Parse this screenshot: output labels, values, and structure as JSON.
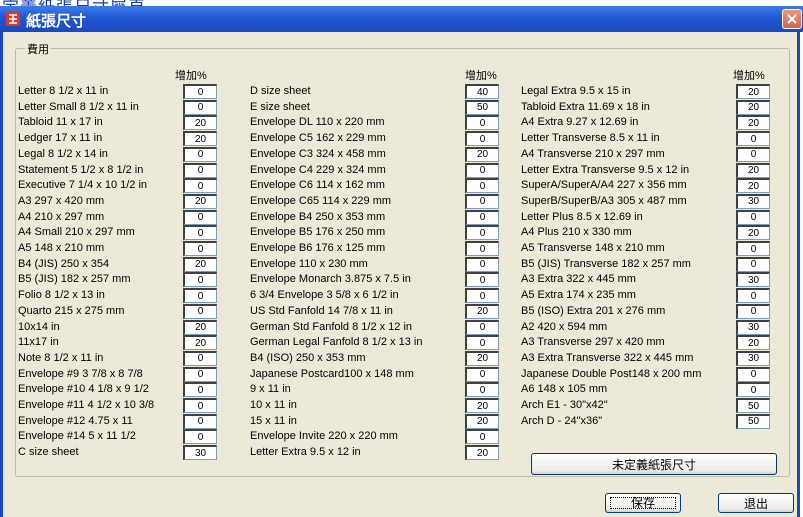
{
  "top_note": "定義紙張尺寸屬頁",
  "window": {
    "title": "紙張尺寸",
    "close_glyph": "✕"
  },
  "group": {
    "label": "費用"
  },
  "columns": [
    {
      "header": "增加%",
      "rows": [
        {
          "label": "Letter 8 1/2 x 11 in",
          "value": "0"
        },
        {
          "label": "Letter Small 8 1/2 x 11 in",
          "value": "0"
        },
        {
          "label": "Tabloid 11 x 17 in",
          "value": "20"
        },
        {
          "label": "Ledger 17 x 11 in",
          "value": "20"
        },
        {
          "label": "Legal 8 1/2 x 14 in",
          "value": "0"
        },
        {
          "label": "Statement 5 1/2 x 8 1/2 in",
          "value": "0"
        },
        {
          "label": "Executive 7 1/4 x 10 1/2 in",
          "value": "0"
        },
        {
          "label": "A3 297 x 420 mm",
          "value": "20"
        },
        {
          "label": "A4 210 x 297 mm",
          "value": "0"
        },
        {
          "label": "A4 Small 210 x 297 mm",
          "value": "0"
        },
        {
          "label": "A5 148 x 210 mm",
          "value": "0"
        },
        {
          "label": "B4 (JIS) 250 x 354",
          "value": "20"
        },
        {
          "label": "B5 (JIS) 182 x 257 mm",
          "value": "0"
        },
        {
          "label": "Folio 8 1/2 x 13 in",
          "value": "0"
        },
        {
          "label": "Quarto 215 x 275 mm",
          "value": "0"
        },
        {
          "label": "10x14 in",
          "value": "20"
        },
        {
          "label": "11x17 in",
          "value": "20"
        },
        {
          "label": "Note 8 1/2 x 11 in",
          "value": "0"
        },
        {
          "label": "Envelope #9 3 7/8 x 8 7/8",
          "value": "0"
        },
        {
          "label": "Envelope #10 4 1/8 x 9 1/2",
          "value": "0"
        },
        {
          "label": "Envelope #11 4 1/2 x 10 3/8",
          "value": "0"
        },
        {
          "label": "Envelope #12 4.75 x 11",
          "value": "0"
        },
        {
          "label": "Envelope #14 5 x 11 1/2",
          "value": "0"
        },
        {
          "label": "C size sheet",
          "value": "30"
        }
      ]
    },
    {
      "header": "增加%",
      "rows": [
        {
          "label": "D size sheet",
          "value": "40"
        },
        {
          "label": "E size sheet",
          "value": "50"
        },
        {
          "label": "Envelope DL 110 x 220 mm",
          "value": "0"
        },
        {
          "label": "Envelope C5 162 x 229 mm",
          "value": "0"
        },
        {
          "label": "Envelope C3  324 x 458 mm",
          "value": "20"
        },
        {
          "label": "Envelope C4  229 x 324 mm",
          "value": "0"
        },
        {
          "label": "Envelope C6  114 x 162 mm",
          "value": "0"
        },
        {
          "label": "Envelope C65 114 x 229 mm",
          "value": "0"
        },
        {
          "label": "Envelope B4  250 x 353 mm",
          "value": "0"
        },
        {
          "label": "Envelope B5  176 x 250 mm",
          "value": "0"
        },
        {
          "label": "Envelope B6  176 x 125 mm",
          "value": "0"
        },
        {
          "label": "Envelope 110 x 230 mm",
          "value": "0"
        },
        {
          "label": "Envelope Monarch 3.875 x 7.5 in",
          "value": "0"
        },
        {
          "label": "6 3/4 Envelope 3 5/8 x 6 1/2 in",
          "value": "0"
        },
        {
          "label": "US Std Fanfold 14 7/8 x 11 in",
          "value": "20"
        },
        {
          "label": "German Std Fanfold 8 1/2 x 12 in",
          "value": "0"
        },
        {
          "label": "German Legal Fanfold 8 1/2 x 13 in",
          "value": "0"
        },
        {
          "label": "B4 (ISO) 250 x 353 mm",
          "value": "20"
        },
        {
          "label": "Japanese Postcard100 x 148 mm",
          "value": "0"
        },
        {
          "label": "9 x 11 in",
          "value": "0"
        },
        {
          "label": "10 x 11 in",
          "value": "20"
        },
        {
          "label": "15 x 11 in",
          "value": "20"
        },
        {
          "label": "Envelope Invite 220 x 220 mm",
          "value": "0"
        },
        {
          "label": "Letter Extra 9.5 x 12 in",
          "value": "20"
        }
      ]
    },
    {
      "header": "增加%",
      "rows": [
        {
          "label": "Legal Extra 9.5 x 15 in",
          "value": "20"
        },
        {
          "label": "Tabloid Extra 11.69 x 18 in",
          "value": "20"
        },
        {
          "label": "A4 Extra 9.27 x 12.69 in",
          "value": "20"
        },
        {
          "label": "Letter Transverse 8.5 x 11 in",
          "value": "0"
        },
        {
          "label": "A4 Transverse 210 x 297 mm",
          "value": "0"
        },
        {
          "label": "Letter Extra Transverse 9.5 x 12 in",
          "value": "20"
        },
        {
          "label": "SuperA/SuperA/A4 227 x 356 mm",
          "value": "20"
        },
        {
          "label": "SuperB/SuperB/A3 305 x 487 mm",
          "value": "30"
        },
        {
          "label": "Letter Plus 8.5 x 12.69 in",
          "value": "0"
        },
        {
          "label": "A4 Plus 210 x 330 mm",
          "value": "20"
        },
        {
          "label": "A5 Transverse 148 x 210 mm",
          "value": "0"
        },
        {
          "label": "B5 (JIS) Transverse 182 x 257 mm",
          "value": "0"
        },
        {
          "label": "A3 Extra 322 x 445 mm",
          "value": "30"
        },
        {
          "label": "A5 Extra 174 x 235 mm",
          "value": "0"
        },
        {
          "label": "B5 (ISO) Extra 201 x 276 mm",
          "value": "0"
        },
        {
          "label": "A2 420 x 594 mm",
          "value": "30"
        },
        {
          "label": "A3 Transverse 297 x 420 mm",
          "value": "20"
        },
        {
          "label": "A3 Extra Transverse 322 x 445 mm",
          "value": "30"
        },
        {
          "label": "Japanese Double Post148 x 200 mm",
          "value": "0"
        },
        {
          "label": "A6 148 x 105 mm",
          "value": "0"
        },
        {
          "label": "Arch E1 - 30\"x42\"",
          "value": "50"
        },
        {
          "label": "Arch D - 24\"x36\"",
          "value": "50"
        }
      ]
    }
  ],
  "buttons": {
    "custom_size": "未定義紙張尺寸",
    "save": "保存",
    "exit": "退出"
  }
}
